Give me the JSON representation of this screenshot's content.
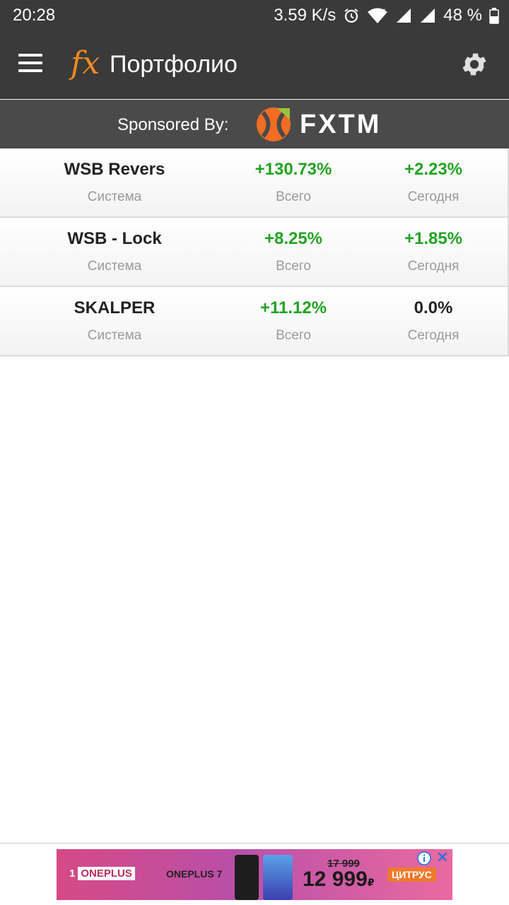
{
  "status_bar": {
    "time": "20:28",
    "network_speed": "3.59 K/s",
    "battery": "48 %",
    "icons": [
      "alarm-icon",
      "wifi-icon",
      "signal-icon",
      "signal-icon",
      "battery-icon"
    ]
  },
  "app_bar": {
    "logo": "fx",
    "title": "Портфолио",
    "menu_icon": "hamburger-menu-icon",
    "settings_icon": "gear-icon"
  },
  "sponsor": {
    "label": "Sponsored By:",
    "brand": "FXTM"
  },
  "portfolio": {
    "rows": [
      {
        "name": "WSB Revers",
        "name_label": "Система",
        "total": "+130.73%",
        "total_label": "Всего",
        "today": "+2.23%",
        "today_label": "Сегодня"
      },
      {
        "name": "WSB - Lock",
        "name_label": "Система",
        "total": "+8.25%",
        "total_label": "Всего",
        "today": "+1.85%",
        "today_label": "Сегодня"
      },
      {
        "name": "SKALPER",
        "name_label": "Система",
        "total": "+11.12%",
        "total_label": "Всего",
        "today": "0.0%",
        "today_label": "Сегодня"
      }
    ]
  },
  "ad": {
    "brand": "ONEPLUS",
    "model": "ONEPLUS 7",
    "old_price": "17 999",
    "new_price": "12 999",
    "currency": "₽",
    "store": "ЦИТРУС",
    "close": "✕"
  },
  "colors": {
    "app_bar": "#3a3a3a",
    "sponsor_bar": "#4a4a4a",
    "positive": "#22a322",
    "accent": "#f28b1d"
  }
}
